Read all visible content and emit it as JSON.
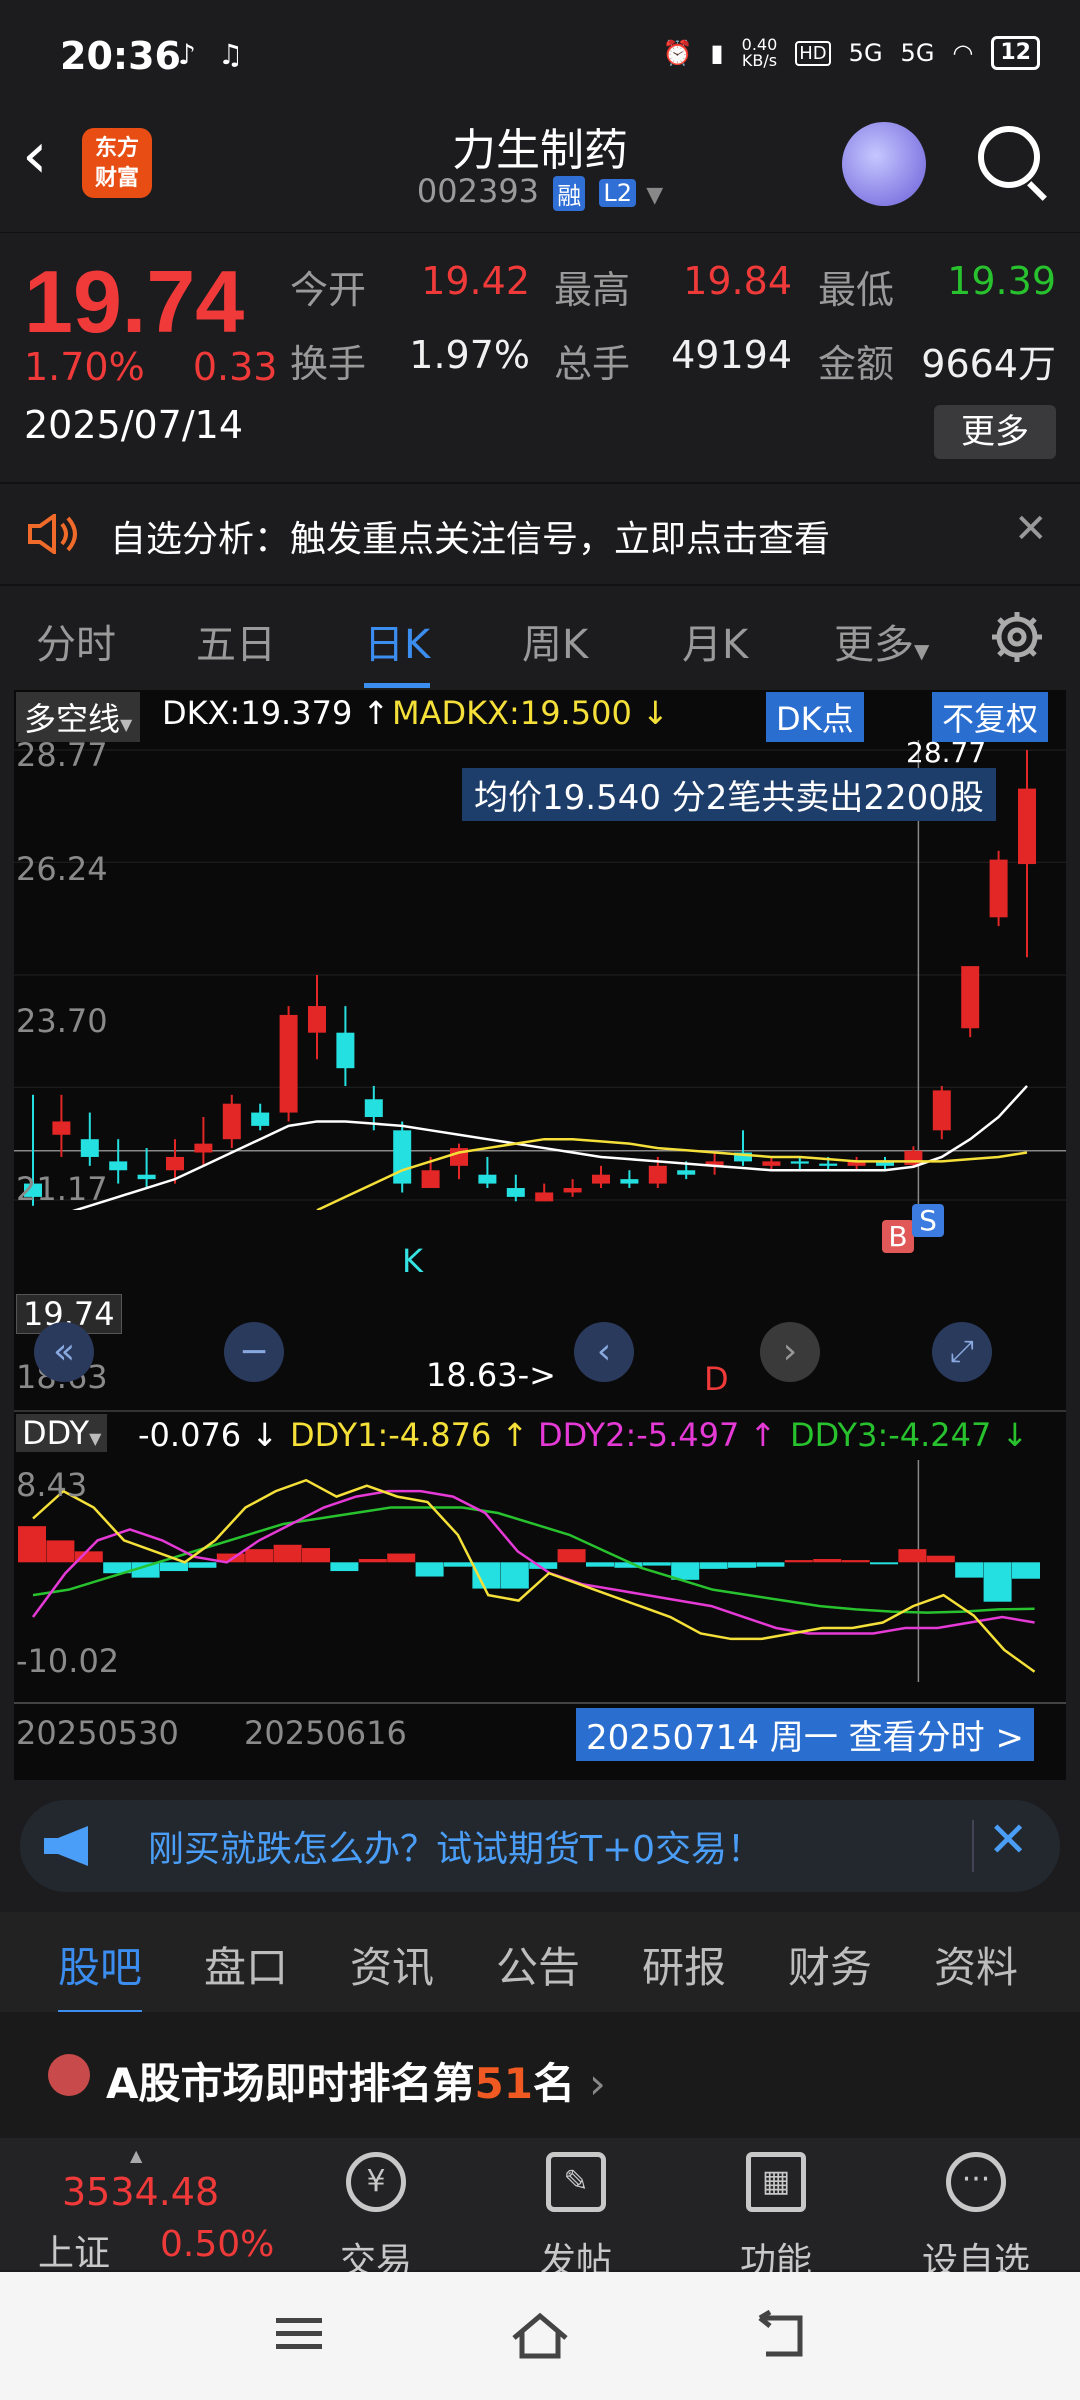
{
  "status": {
    "time": "20:36",
    "net_speed": "0.40\nKB/s",
    "net_1": "HD",
    "net_2": "5G",
    "net_3": "5G",
    "battery": "12"
  },
  "header": {
    "logo": "东方\n财富",
    "title": "力生制药",
    "code": "002393",
    "tag_margin": "融",
    "tag_level": "L2"
  },
  "quote": {
    "price": "19.74",
    "pct": "1.70%",
    "chg": "0.33",
    "date": "2025/07/14",
    "open_label": "今开",
    "open": "19.42",
    "high_label": "最高",
    "high": "19.84",
    "low_label": "最低",
    "low": "19.39",
    "turnover_label": "换手",
    "turnover": "1.97%",
    "volume_label": "总手",
    "volume": "49194",
    "amount_label": "金额",
    "amount": "9664万",
    "more": "更多"
  },
  "banner": {
    "text": "自选分析：触发重点关注信号，立即点击查看",
    "close": "✕"
  },
  "ktabs": [
    "分时",
    "五日",
    "日K",
    "周K",
    "月K",
    "更多"
  ],
  "chart": {
    "indicator": "多空线",
    "dkx": "DKX:19.379 ↑",
    "madkx": "MADKX:19.500 ↓",
    "dk_btn": "DK点",
    "fq_btn": "不复权",
    "y_labels": [
      "28.77",
      "26.24",
      "23.70",
      "21.17",
      "18.63"
    ],
    "cur_price": "19.74",
    "tooltip": "均价19.540  分2笔共卖出2200股",
    "top_mark": "28.77",
    "low_mark": "18.63->",
    "mark_k": "K",
    "mark_d": "D",
    "mark_b": "B",
    "mark_s": "S",
    "ddy_label": "DDY",
    "ddy": "-0.076 ↓",
    "ddy1": "DDY1:-4.876 ↑",
    "ddy2": "DDY2:-5.497 ↑",
    "ddy3": "DDY3:-4.247 ↓",
    "ddy_top": "8.43",
    "ddy_bottom": "-10.02",
    "date1": "20250530",
    "date2": "20250616",
    "date_btn": "20250714 周一 查看分时 >"
  },
  "chart_data": {
    "type": "candlestick",
    "candles": [
      {
        "o": 19.0,
        "c": 18.7,
        "h": 21.0,
        "l": 18.5
      },
      {
        "o": 20.1,
        "c": 20.4,
        "h": 21.0,
        "l": 19.6
      },
      {
        "o": 20.0,
        "c": 19.6,
        "h": 20.6,
        "l": 19.4
      },
      {
        "o": 19.5,
        "c": 19.3,
        "h": 20.0,
        "l": 19.0
      },
      {
        "o": 19.2,
        "c": 19.1,
        "h": 19.8,
        "l": 18.9
      },
      {
        "o": 19.3,
        "c": 19.6,
        "h": 20.0,
        "l": 19.0
      },
      {
        "o": 19.7,
        "c": 19.9,
        "h": 20.5,
        "l": 19.4
      },
      {
        "o": 20.0,
        "c": 20.8,
        "h": 21.0,
        "l": 19.8
      },
      {
        "o": 20.6,
        "c": 20.3,
        "h": 20.8,
        "l": 20.2
      },
      {
        "o": 20.6,
        "c": 22.8,
        "h": 23.0,
        "l": 20.4
      },
      {
        "o": 22.4,
        "c": 23.0,
        "h": 23.7,
        "l": 21.8
      },
      {
        "o": 22.4,
        "c": 21.6,
        "h": 23.0,
        "l": 21.2
      },
      {
        "o": 20.9,
        "c": 20.5,
        "h": 21.2,
        "l": 20.2
      },
      {
        "o": 20.2,
        "c": 19.0,
        "h": 20.4,
        "l": 18.8
      },
      {
        "o": 18.9,
        "c": 19.3,
        "h": 19.6,
        "l": 18.9
      },
      {
        "o": 19.4,
        "c": 19.8,
        "h": 19.9,
        "l": 19.1
      },
      {
        "o": 19.2,
        "c": 19.0,
        "h": 19.6,
        "l": 18.9
      },
      {
        "o": 18.9,
        "c": 18.7,
        "h": 19.2,
        "l": 18.6
      },
      {
        "o": 18.6,
        "c": 18.8,
        "h": 19.0,
        "l": 18.6
      },
      {
        "o": 18.8,
        "c": 18.9,
        "h": 19.1,
        "l": 18.7
      },
      {
        "o": 19.0,
        "c": 19.2,
        "h": 19.4,
        "l": 18.9
      },
      {
        "o": 19.1,
        "c": 19.0,
        "h": 19.3,
        "l": 18.9
      },
      {
        "o": 19.0,
        "c": 19.4,
        "h": 19.6,
        "l": 18.9
      },
      {
        "o": 19.3,
        "c": 19.2,
        "h": 19.5,
        "l": 19.1
      },
      {
        "o": 19.4,
        "c": 19.5,
        "h": 19.7,
        "l": 19.2
      },
      {
        "o": 19.7,
        "c": 19.5,
        "h": 20.2,
        "l": 19.4
      },
      {
        "o": 19.4,
        "c": 19.5,
        "h": 19.6,
        "l": 19.3
      },
      {
        "o": 19.5,
        "c": 19.45,
        "h": 19.6,
        "l": 19.3
      },
      {
        "o": 19.45,
        "c": 19.4,
        "h": 19.6,
        "l": 19.3
      },
      {
        "o": 19.4,
        "c": 19.5,
        "h": 19.6,
        "l": 19.3
      },
      {
        "o": 19.5,
        "c": 19.4,
        "h": 19.6,
        "l": 19.3
      },
      {
        "o": 19.42,
        "c": 19.74,
        "h": 19.84,
        "l": 19.39
      },
      {
        "o": 20.2,
        "c": 21.1,
        "h": 21.2,
        "l": 20.0
      },
      {
        "o": 22.5,
        "c": 23.9,
        "h": 23.9,
        "l": 22.3
      },
      {
        "o": 25.0,
        "c": 26.3,
        "h": 26.5,
        "l": 24.8
      },
      {
        "o": 26.2,
        "c": 27.9,
        "h": 28.77,
        "l": 24.1
      }
    ],
    "y_ticks": [
      28.77,
      26.24,
      23.7,
      21.17,
      18.63
    ],
    "ylim": [
      18.63,
      28.77
    ],
    "x_ticks": [
      "20250530",
      "20250616"
    ],
    "series": [
      {
        "name": "DKX",
        "values": [
          18.1,
          18.3,
          18.5,
          18.7,
          18.9,
          19.1,
          19.4,
          19.7,
          20.0,
          20.3,
          20.4,
          20.4,
          20.35,
          20.3,
          20.2,
          20.1,
          20.0,
          19.9,
          19.8,
          19.7,
          19.6,
          19.55,
          19.5,
          19.45,
          19.4,
          19.35,
          19.3,
          19.3,
          19.3,
          19.3,
          19.3,
          19.38,
          19.6,
          20.0,
          20.5,
          21.2
        ]
      },
      {
        "name": "MADKX",
        "values": [
          null,
          null,
          null,
          null,
          null,
          null,
          null,
          null,
          null,
          null,
          18.4,
          18.7,
          19.0,
          19.3,
          19.5,
          19.7,
          19.8,
          19.9,
          20.0,
          20.0,
          19.95,
          19.9,
          19.8,
          19.75,
          19.7,
          19.65,
          19.6,
          19.6,
          19.55,
          19.5,
          19.5,
          19.5,
          19.5,
          19.55,
          19.6,
          19.7
        ]
      }
    ],
    "ddy": {
      "ylim": [
        -10.02,
        8.43
      ],
      "bars": [
        3.3,
        2.0,
        1.0,
        -1.0,
        -1.4,
        -0.8,
        -0.5,
        0.8,
        1.2,
        1.6,
        1.3,
        -0.8,
        0.3,
        0.8,
        -1.3,
        -0.4,
        -2.4,
        -2.4,
        -0.6,
        1.2,
        -0.4,
        -0.5,
        -0.3,
        -1.6,
        -0.6,
        -0.5,
        -0.4,
        0.2,
        0.3,
        0.2,
        -0.1,
        1.2,
        0.6,
        -1.4,
        -3.6,
        -1.5
      ],
      "ddy1": [
        4.0,
        6.5,
        5.0,
        2.0,
        1.0,
        0.0,
        2.0,
        5.0,
        6.5,
        7.5,
        6.0,
        7.0,
        6.0,
        5.5,
        2.5,
        -3.0,
        -3.5,
        -1.0,
        -2.0,
        -3.0,
        -4.0,
        -5.0,
        -6.5,
        -7.0,
        -7.0,
        -6.5,
        -6.0,
        -6.0,
        -5.5,
        -4.0,
        -3.0,
        -4.876,
        -8.0,
        -10.0
      ],
      "ddy2": [
        -5.0,
        -1.0,
        2.0,
        3.0,
        2.0,
        0.5,
        0.0,
        2.0,
        3.5,
        5.0,
        6.0,
        6.5,
        6.5,
        6.0,
        4.5,
        1.0,
        -1.0,
        -2.0,
        -2.5,
        -3.0,
        -3.5,
        -4.0,
        -5.0,
        -6.0,
        -6.5,
        -6.5,
        -6.5,
        -6.0,
        -6.0,
        -5.5,
        -5.0,
        -5.497
      ],
      "ddy3": [
        -3.0,
        -2.5,
        -1.5,
        -0.5,
        0.5,
        1.5,
        2.5,
        3.5,
        4.0,
        4.5,
        5.0,
        5.0,
        5.0,
        4.5,
        3.5,
        2.5,
        1.0,
        -0.5,
        -1.5,
        -2.5,
        -3.0,
        -3.5,
        -4.0,
        -4.3,
        -4.5,
        -4.6,
        -4.5,
        -4.3,
        -4.247
      ]
    }
  },
  "notice": {
    "text": "刚买就跌怎么办？试试期货T+0交易！",
    "close": "✕"
  },
  "btabs": [
    "股吧",
    "盘口",
    "资讯",
    "公告",
    "研报",
    "财务",
    "资料"
  ],
  "rank": {
    "prefix": "A股市场即时排名第",
    "num": "51",
    "suffix": "名",
    "arrow": "›"
  },
  "bottomnav": {
    "index_val": "3534.48",
    "index_name": "上证",
    "index_pct": "0.50%",
    "items": [
      "交易",
      "发帖",
      "功能",
      "设自选"
    ]
  }
}
